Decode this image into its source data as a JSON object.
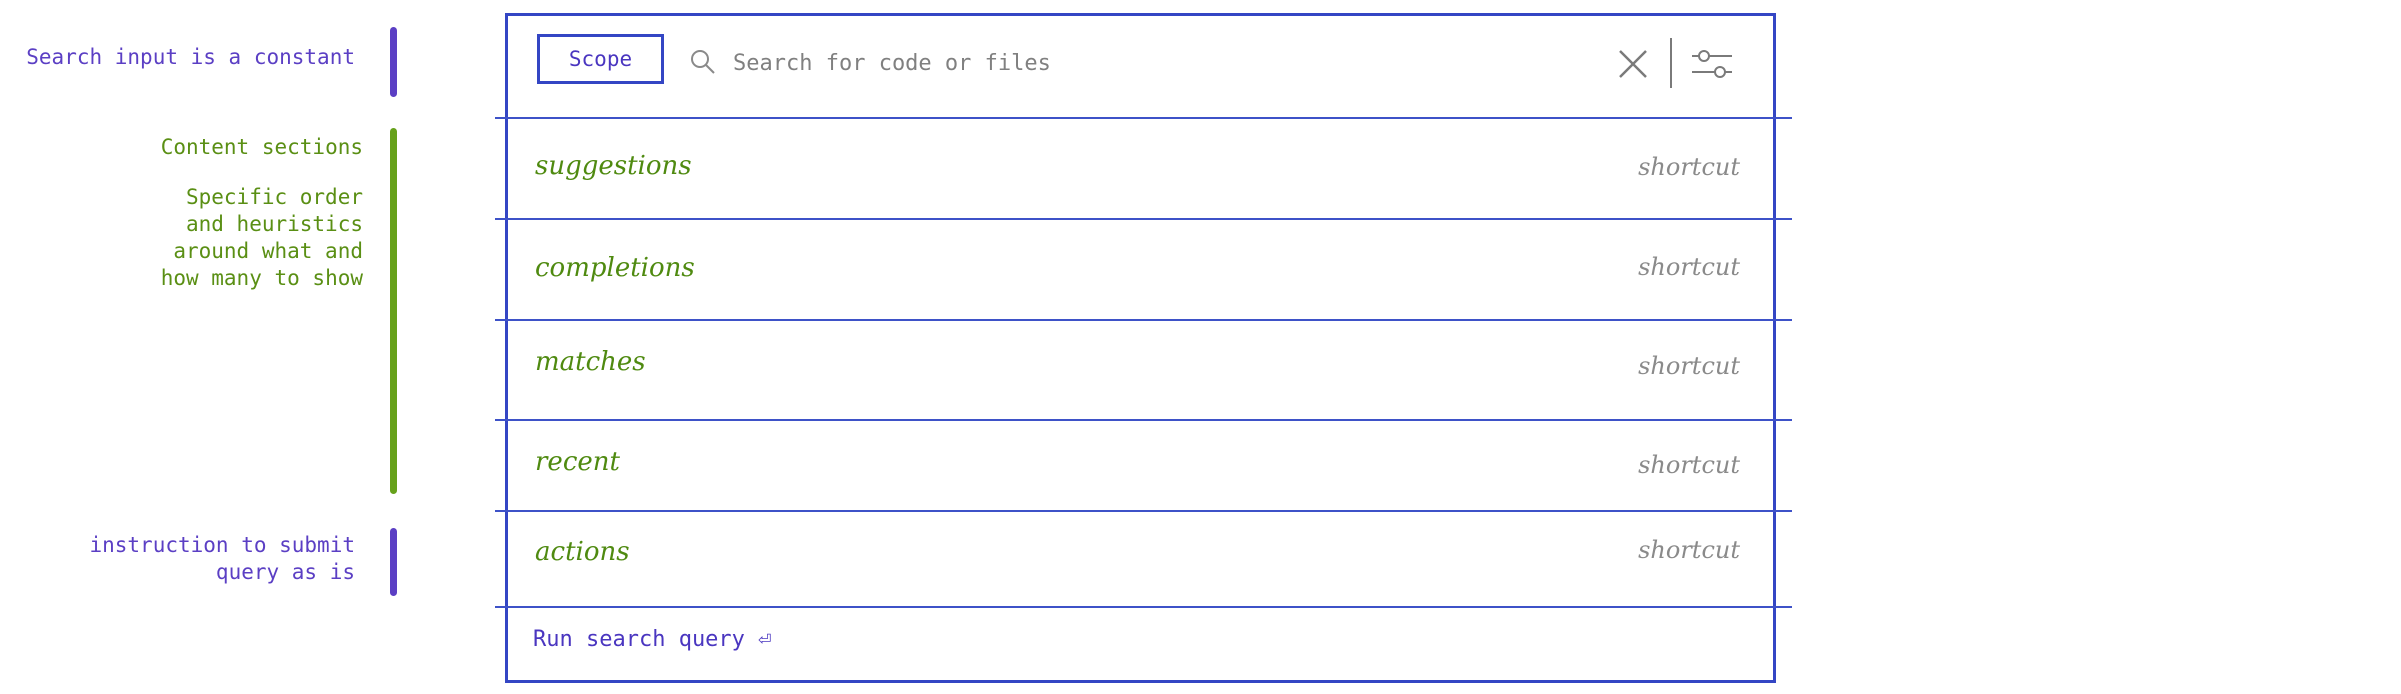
{
  "annotations": {
    "search_constant": "Search input is a constant",
    "content_sections_title": "Content sections",
    "content_sections_detail": "Specific order\nand heuristics\naround what and\nhow many to show",
    "submit_instruction": "instruction to submit\nquery as is"
  },
  "search": {
    "scope_label": "Scope",
    "placeholder": "Search for code or files",
    "value": ""
  },
  "sections": [
    {
      "label": "suggestions",
      "shortcut": "shortcut"
    },
    {
      "label": "completions",
      "shortcut": "shortcut"
    },
    {
      "label": "matches",
      "shortcut": "shortcut"
    },
    {
      "label": "recent",
      "shortcut": "shortcut"
    },
    {
      "label": "actions",
      "shortcut": "shortcut"
    }
  ],
  "footer": {
    "run_query_label": "Run search query ⏎"
  },
  "colors": {
    "panel_border": "#3446c4",
    "annotation_purple": "#5b3fc4",
    "annotation_green": "#66a11b",
    "section_text": "#4f8a10",
    "muted_text": "#8a8a8a"
  },
  "icons": {
    "search": "search-icon",
    "clear": "close-icon",
    "filter": "filter-sliders-icon",
    "enter": "return-icon"
  }
}
